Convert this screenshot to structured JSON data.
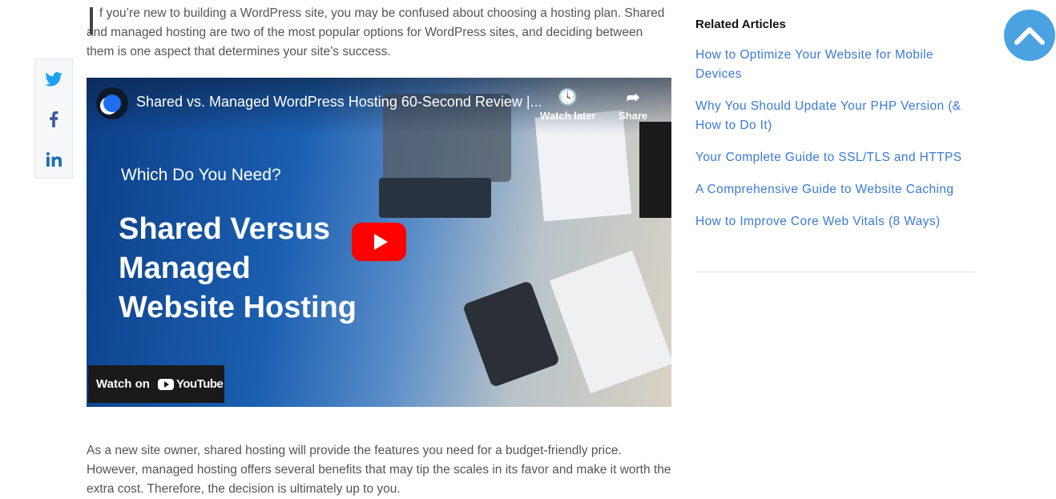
{
  "intro": {
    "drop_cap": "I",
    "text": "f you’re new to building a WordPress site, you may be confused about choosing a hosting plan. Shared and managed hosting are two of the most popular options for WordPress sites, and deciding between them is one aspect that determines your site’s success."
  },
  "share": {
    "icons": [
      "twitter-icon",
      "facebook-icon",
      "linkedin-icon"
    ]
  },
  "video": {
    "title": "Shared vs. Managed WordPress Hosting 60-Second Review |...",
    "watch_later": "Watch later",
    "share": "Share",
    "subtitle": "Which Do You Need?",
    "headline_1": "Shared Versus",
    "headline_2": "Managed",
    "headline_3": "Website Hosting",
    "watch_on": "Watch on",
    "youtube": "YouTube"
  },
  "after": {
    "text": "As a new site owner, shared hosting will provide the features you need for a budget-friendly price. However, managed hosting offers several benefits that may tip the scales in its favor and make it worth the extra cost. Therefore, the decision is ultimately up to you."
  },
  "sidebar": {
    "heading": "Related Articles",
    "links": [
      "How to Optimize Your Website for Mobile Devices",
      "Why You Should Update Your PHP Version (& How to Do It)",
      "Your Complete Guide to SSL/TLS and HTTPS",
      "A Comprehensive Guide to Website Caching",
      "How to Improve Core Web Vitals (8 Ways)"
    ]
  },
  "colors": {
    "link": "#3a7bd5",
    "scroll_top": "#4aa3e0",
    "youtube_red": "#ff0000"
  }
}
